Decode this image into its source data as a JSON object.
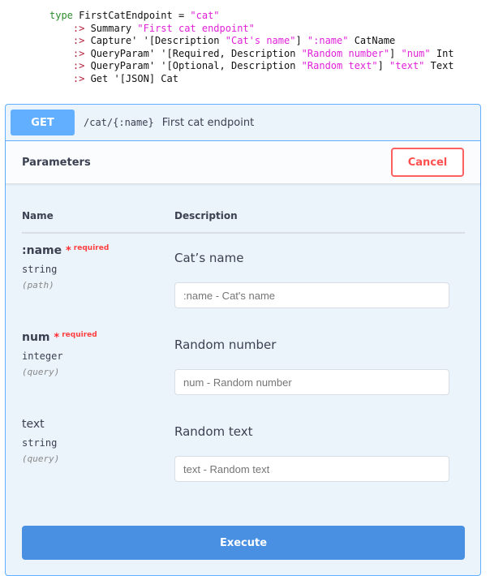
{
  "code": {
    "l1a": "type",
    "l1b": " FirstCatEndpoint = ",
    "l1c": "\"cat\"",
    "op": ":>",
    "l2a": " Summary ",
    "l2b": "\"First cat endpoint\"",
    "l3a": " Capture' '[Description ",
    "l3b": "\"Cat's name\"",
    "l3c": "] ",
    "l3d": "\":name\"",
    "l3e": " CatName",
    "l4a": " QueryParam' '[Required, Description ",
    "l4b": "\"Random number\"",
    "l4c": "] ",
    "l4d": "\"num\"",
    "l4e": " Int",
    "l5a": " QueryParam' '[Optional, Description ",
    "l5b": "\"Random text\"",
    "l5c": "] ",
    "l5d": "\"text\"",
    "l5e": " Text",
    "l6a": " Get '[JSON] Cat"
  },
  "endpoint": {
    "method": "GET",
    "path": "/cat/{:name}",
    "summary": "First cat endpoint"
  },
  "params": {
    "title": "Parameters",
    "cancel": "Cancel",
    "col_name": "Name",
    "col_desc": "Description",
    "required_label": "required",
    "star": "*",
    "items": [
      {
        "name": ":name",
        "type": "string",
        "in": "(path)",
        "desc": "Cat’s name",
        "placeholder": ":name - Cat's name"
      },
      {
        "name": "num",
        "type": "integer",
        "in": "(query)",
        "desc": "Random number",
        "placeholder": "num - Random number"
      },
      {
        "name": "text",
        "type": "string",
        "in": "(query)",
        "desc": "Random text",
        "placeholder": "text - Random text"
      }
    ]
  },
  "execute": "Execute"
}
